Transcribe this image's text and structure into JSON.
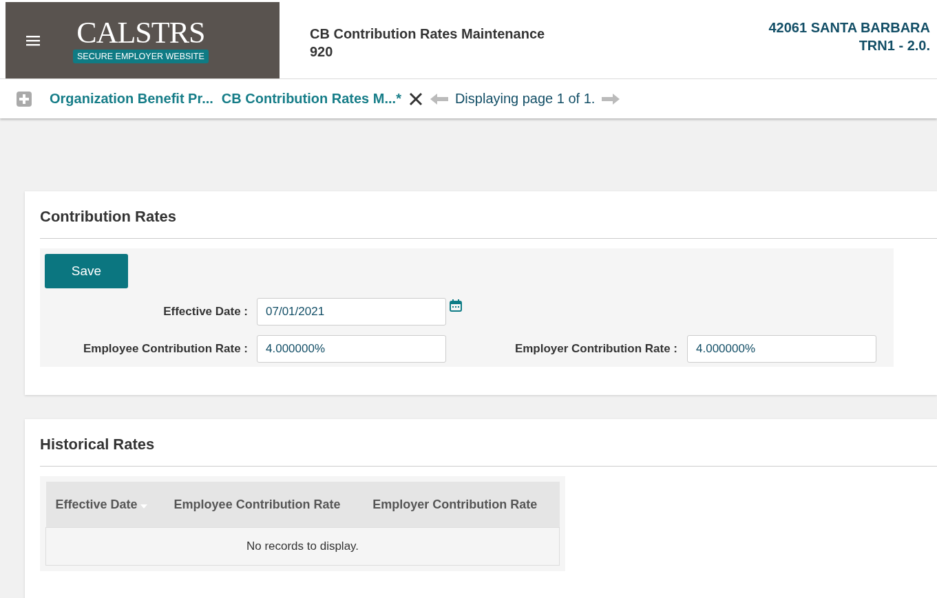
{
  "header": {
    "logo": {
      "name": "CALSTRS",
      "tagline": "SECURE EMPLOYER WEBSITE"
    },
    "title": "CB Contribution Rates Maintenance",
    "subtitle": "920",
    "employer": "42061 SANTA BARBARA",
    "environment": "TRN1 - 2.0."
  },
  "breadcrumbs": [
    {
      "label": "Organization Benefit Pr..."
    },
    {
      "label": "CB Contribution Rates M...*"
    }
  ],
  "pager": {
    "text": "Displaying page 1 of 1."
  },
  "contribution_rates": {
    "title": "Contribution Rates",
    "save_label": "Save",
    "effective_date": {
      "label": "Effective Date :",
      "value": "07/01/2021"
    },
    "employee_rate": {
      "label": "Employee Contribution Rate :",
      "value": "4.000000%"
    },
    "employer_rate": {
      "label": "Employer Contribution Rate :",
      "value": "4.000000%"
    }
  },
  "historical_rates": {
    "title": "Historical Rates",
    "columns": [
      {
        "label": "Effective Date",
        "sorted": true
      },
      {
        "label": "Employee Contribution Rate",
        "sorted": false
      },
      {
        "label": "Employer Contribution Rate",
        "sorted": false
      }
    ],
    "empty_message": "No records to display."
  }
}
